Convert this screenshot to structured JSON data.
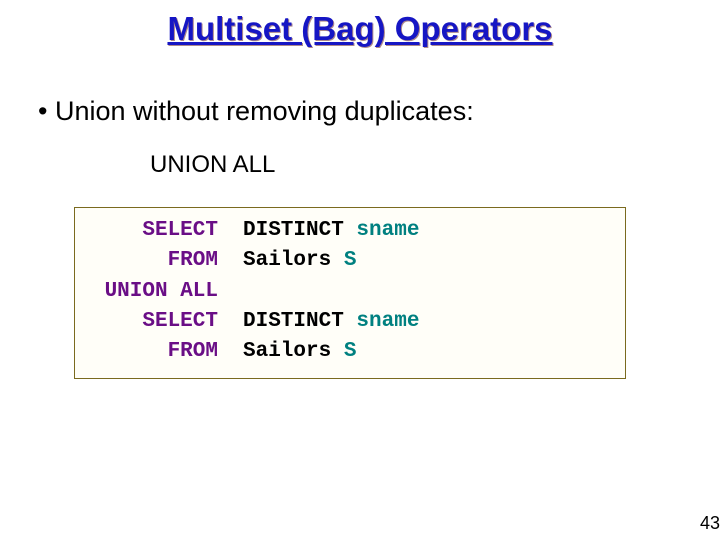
{
  "title": "Multiset (Bag) Operators",
  "bullet": "Union without removing duplicates:",
  "sub": "UNION ALL",
  "code": {
    "r0": {
      "kw": "SELECT",
      "arg_pre": "DISTINCT ",
      "arg_id": "sname"
    },
    "r1": {
      "kw": "FROM",
      "arg_pre": "Sailors ",
      "arg_id": "S"
    },
    "r2": {
      "kw": "UNION ALL",
      "arg_pre": "",
      "arg_id": ""
    },
    "r3": {
      "kw": "SELECT",
      "arg_pre": "DISTINCT ",
      "arg_id": "sname"
    },
    "r4": {
      "kw": "FROM",
      "arg_pre": "Sailors ",
      "arg_id": "S"
    }
  },
  "pagenum": "43"
}
